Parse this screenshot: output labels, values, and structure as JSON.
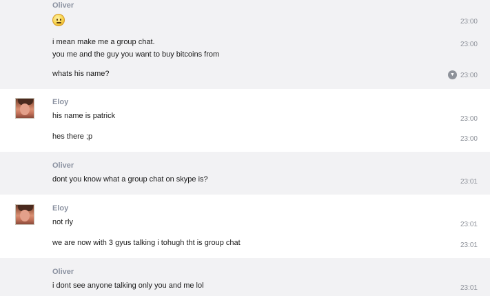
{
  "emoji": "smiley-emoji",
  "blocks": [
    {
      "author": "Oliver",
      "messages": [
        {
          "text": "",
          "time": "23:00"
        },
        {
          "text": "i mean make me a group chat.",
          "time": "23:00"
        },
        {
          "text": "you me and the guy you want to buy bitcoins from",
          "time": ""
        },
        {
          "text": "whats his name?",
          "time": "23:00"
        }
      ]
    },
    {
      "author": "Eloy",
      "messages": [
        {
          "text": "his name is patrick",
          "time": "23:00"
        },
        {
          "text": "hes there ;p",
          "time": "23:00"
        }
      ]
    },
    {
      "author": "Oliver",
      "messages": [
        {
          "text": "dont you know what a group chat on skype is?",
          "time": "23:01"
        }
      ]
    },
    {
      "author": "Eloy",
      "messages": [
        {
          "text": "not rly",
          "time": "23:01"
        },
        {
          "text": "we are now with 3 gyus talking i tohugh tht is group chat",
          "time": "23:01"
        }
      ]
    },
    {
      "author": "Oliver",
      "messages": [
        {
          "text": "i dont see anyone talking only you and me lol",
          "time": "23:01"
        }
      ]
    }
  ],
  "colors": {
    "gray_block": "#f2f2f4",
    "author": "#8a91a0",
    "time": "#8e929a"
  }
}
